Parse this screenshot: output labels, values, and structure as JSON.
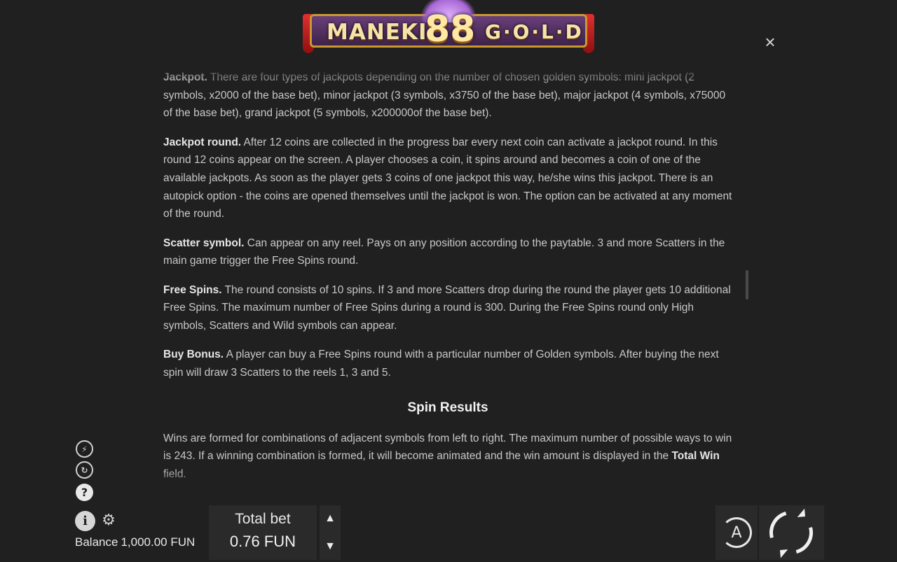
{
  "logo": {
    "text_left": "MANEKI",
    "text_mid": "88",
    "text_right": "G·O·L·D",
    "icon": "maneki-88-gold-logo"
  },
  "close_label": "×",
  "paragraphs": [
    {
      "title": "Jackpot.",
      "text": " There are four types of jackpots depending on the number of chosen golden symbols: mini jackpot (2 symbols, x2000 of the base bet), minor jackpot (3 symbols, x3750 of the base bet), major jackpot (4 symbols, x75000 of the base bet), grand jackpot (5 symbols, x200000of the base bet)."
    },
    {
      "title": "Jackpot round.",
      "text": " After 12 coins are collected in the progress bar every next coin can activate a jackpot round. In this round 12 coins appear on the screen. A player chooses a coin, it spins around and becomes a coin of one of the available jackpots. As soon as the player gets 3 coins of one jackpot this way, he/she wins this jackpot. There is an autopick option - the coins are opened themselves until the jackpot is won. The option can be activated at any moment of the round."
    },
    {
      "title": "Scatter symbol.",
      "text": " Can appear on any reel. Pays on any position according to the paytable. 3 and more Scatters in the main game trigger the Free Spins round."
    },
    {
      "title": "Free Spins.",
      "text": " The round consists of 10 spins. If 3 and more Scatters drop during the round the player gets 10 additional Free Spins. The maximum number of Free Spins during a round is 300. During the Free Spins round only High symbols, Scatters and Wild symbols can appear."
    },
    {
      "title": "Buy Bonus.",
      "text": " A player can buy a Free Spins round with a particular number of Golden symbols. After buying the next spin will draw 3 Scatters to the reels 1, 3 and 5."
    }
  ],
  "section_title": "Spin Results",
  "spin_results": {
    "text": "Wins are formed for combinations of adjacent symbols from left to right. The maximum number of possible ways to win is 243. If a winning combination is formed, it will become animated and the win amount is displayed in the ",
    "bold": "Total Win",
    "tail": " field."
  },
  "side_icons": {
    "turbo": "turbo-icon",
    "auto": "autoplay-icon",
    "help": "?",
    "info": "i",
    "gear": "gear-icon"
  },
  "balance": {
    "label": "Balance",
    "value": "1,000.00 FUN"
  },
  "bet": {
    "label": "Total bet",
    "value": "0.76 FUN"
  },
  "auto_button_label": "A"
}
